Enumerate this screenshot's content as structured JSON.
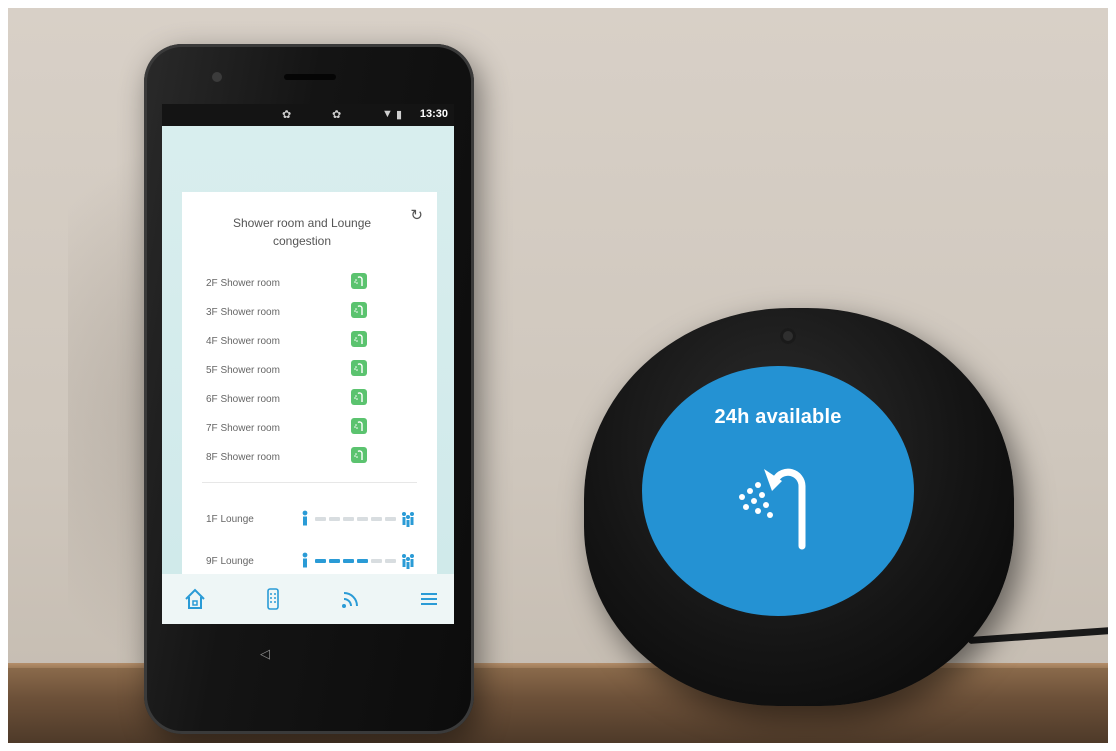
{
  "phone": {
    "status_time": "13:30",
    "card": {
      "title": "Shower room and Lounge congestion",
      "refresh_icon": "refresh-icon",
      "shower_rooms": [
        {
          "label": "2F Shower room",
          "status_icon": "shower-available-icon",
          "status_color": "#5bc36f"
        },
        {
          "label": "3F Shower room",
          "status_icon": "shower-available-icon",
          "status_color": "#5bc36f"
        },
        {
          "label": "4F Shower room",
          "status_icon": "shower-available-icon",
          "status_color": "#5bc36f"
        },
        {
          "label": "5F Shower room",
          "status_icon": "shower-available-icon",
          "status_color": "#5bc36f"
        },
        {
          "label": "6F Shower room",
          "status_icon": "shower-available-icon",
          "status_color": "#5bc36f"
        },
        {
          "label": "7F Shower room",
          "status_icon": "shower-available-icon",
          "status_color": "#5bc36f"
        },
        {
          "label": "8F Shower room",
          "status_icon": "shower-available-icon",
          "status_color": "#5bc36f"
        }
      ],
      "lounges": [
        {
          "label": "1F Lounge",
          "level_segments": 0,
          "total_segments": 6
        },
        {
          "label": "9F Lounge",
          "level_segments": 4,
          "total_segments": 6
        }
      ]
    },
    "nav_icons": [
      "home-icon",
      "remote-icon",
      "wifi-icon",
      "menu-icon"
    ],
    "accent_color": "#2a9bd6"
  },
  "echo": {
    "message": "24h available",
    "icon": "shower-icon",
    "screen_color": "#2492d3"
  }
}
